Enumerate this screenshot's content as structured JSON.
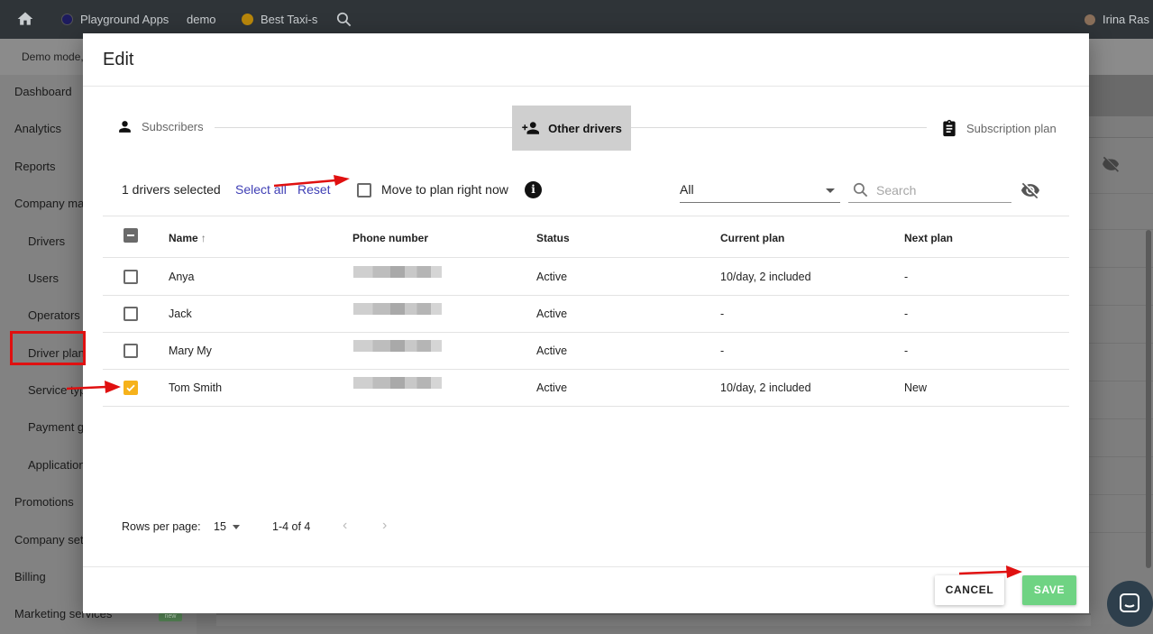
{
  "topbar": {
    "items": [
      {
        "label": "Playground Apps",
        "dot_color": "#1d1b5e"
      },
      {
        "label": "demo"
      },
      {
        "label": "Best Taxi-s",
        "dot_color": "#b8860b"
      }
    ],
    "user": "Irina Ras"
  },
  "subbar": {
    "text": "Demo mode,"
  },
  "sidebar": {
    "items": [
      "Dashboard",
      "Analytics",
      "Reports",
      "Company ma",
      "Drivers",
      "Users",
      "Operators",
      "Driver plan",
      "Service typ",
      "Payment ga",
      "Application",
      "Promotions",
      "Company sett",
      "Billing",
      "Marketing services"
    ],
    "badge": "new"
  },
  "dialog": {
    "title": "Edit",
    "steps": [
      {
        "label": "Subscribers",
        "icon": "person-icon"
      },
      {
        "label": "Other drivers",
        "icon": "person-add-icon",
        "active": true
      },
      {
        "label": "Subscription plan",
        "icon": "clipboard-icon"
      }
    ],
    "toolbar": {
      "selected_text": "1 drivers selected",
      "select_all": "Select all",
      "reset": "Reset",
      "move_label": "Move to plan right now",
      "filter_value": "All",
      "search_placeholder": "Search"
    },
    "table": {
      "headers": [
        "Name",
        "Phone number",
        "Status",
        "Current plan",
        "Next plan"
      ],
      "rows": [
        {
          "name": "Anya",
          "status": "Active",
          "current": "10/day, 2 included",
          "next": "-",
          "checked": false
        },
        {
          "name": "Jack",
          "status": "Active",
          "current": "-",
          "next": "-",
          "checked": false
        },
        {
          "name": "Mary My",
          "status": "Active",
          "current": "-",
          "next": "-",
          "checked": false
        },
        {
          "name": "Tom Smith",
          "status": "Active",
          "current": "10/day, 2 included",
          "next": "New",
          "checked": true
        }
      ]
    },
    "pagination": {
      "rows_label": "Rows per page:",
      "rows_value": "15",
      "range": "1-4 of 4"
    },
    "buttons": {
      "cancel": "CANCEL",
      "save": "SAVE"
    }
  },
  "colors": {
    "accent_link": "#3f3fb5",
    "checkbox_checked": "#f6b21b",
    "save_button": "#6fd383",
    "annotation": "#e01010"
  }
}
